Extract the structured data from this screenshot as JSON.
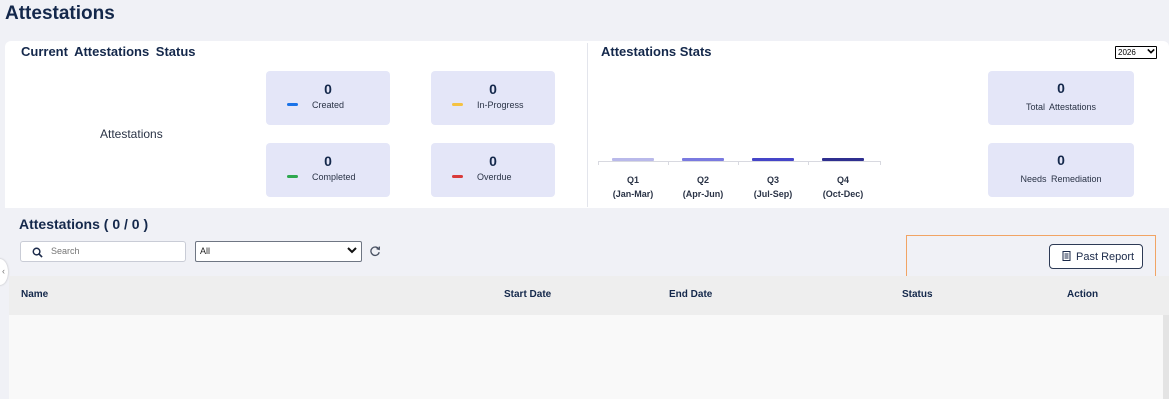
{
  "page": {
    "title": "Attestations"
  },
  "status_section": {
    "title": "Current  Attestations  Status",
    "donut_label": "Attestations",
    "cards": [
      {
        "value": "0",
        "label": "Created",
        "color": "#1a73e8"
      },
      {
        "value": "0",
        "label": "In-Progress",
        "color": "#f5c242"
      },
      {
        "value": "0",
        "label": "Completed",
        "color": "#2ea84f"
      },
      {
        "value": "0",
        "label": "Overdue",
        "color": "#d93a3a"
      }
    ]
  },
  "stats_section": {
    "title": "Attestations Stats",
    "year": "2026",
    "quarters": [
      {
        "q": "Q1",
        "range": "(Jan-Mar)",
        "color": "#b9b9ea"
      },
      {
        "q": "Q2",
        "range": "(Apr-Jun)",
        "color": "#7a7ae0"
      },
      {
        "q": "Q3",
        "range": "(Jul-Sep)",
        "color": "#4545c8"
      },
      {
        "q": "Q4",
        "range": "(Oct-Dec)",
        "color": "#2f2f8f"
      }
    ],
    "summary": [
      {
        "value": "0",
        "label": "Total  Attestations"
      },
      {
        "value": "0",
        "label": "Needs Remediation"
      }
    ]
  },
  "list": {
    "title": "Attestations ( 0 / 0 )",
    "search_placeholder": "Search",
    "status_filter": "All",
    "past_report_label": "Past Report",
    "columns": [
      "Name",
      "Start Date",
      "End Date",
      "Status",
      "Action"
    ]
  },
  "chart_data": {
    "type": "bar",
    "categories": [
      "Q1 (Jan-Mar)",
      "Q2 (Apr-Jun)",
      "Q3 (Jul-Sep)",
      "Q4 (Oct-Dec)"
    ],
    "values": [
      0,
      0,
      0,
      0
    ],
    "title": "Attestations Stats",
    "xlabel": "",
    "ylabel": ""
  }
}
